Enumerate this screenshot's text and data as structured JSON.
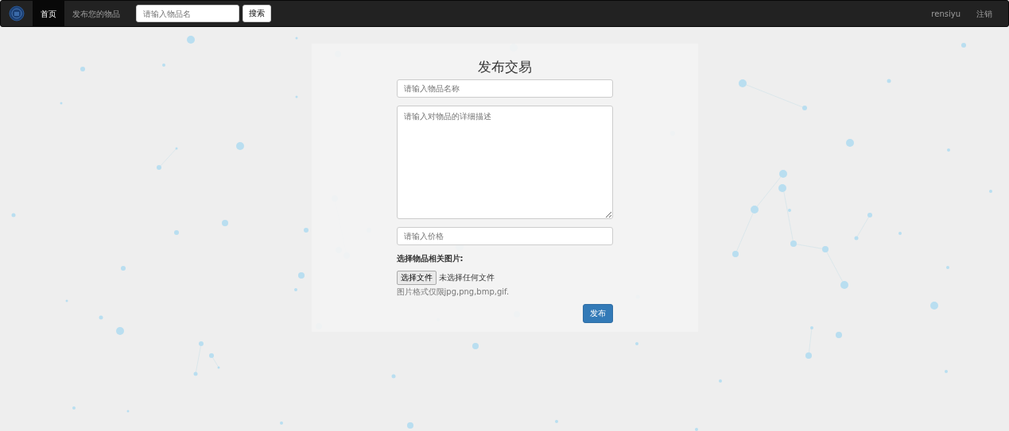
{
  "navbar": {
    "nav_items": [
      {
        "label": "首页",
        "selected": true
      },
      {
        "label": "发布您的物品",
        "selected": false
      }
    ],
    "search": {
      "placeholder": "请输入物品名",
      "button": "搜索"
    },
    "user": "rensiyu",
    "logout": "注销"
  },
  "form": {
    "title": "发布交易",
    "name_field": {
      "placeholder": "请输入物品名称"
    },
    "description_field": {
      "placeholder": "请输入对物品的详细描述"
    },
    "price_field": {
      "placeholder": "请输入价格"
    },
    "image_label": "选择物品相关图片:",
    "file_button": "选择文件",
    "file_status": "未选择任何文件",
    "help_text": "图片格式仅限jpg,png,bmp,gif.",
    "submit": "发布"
  }
}
